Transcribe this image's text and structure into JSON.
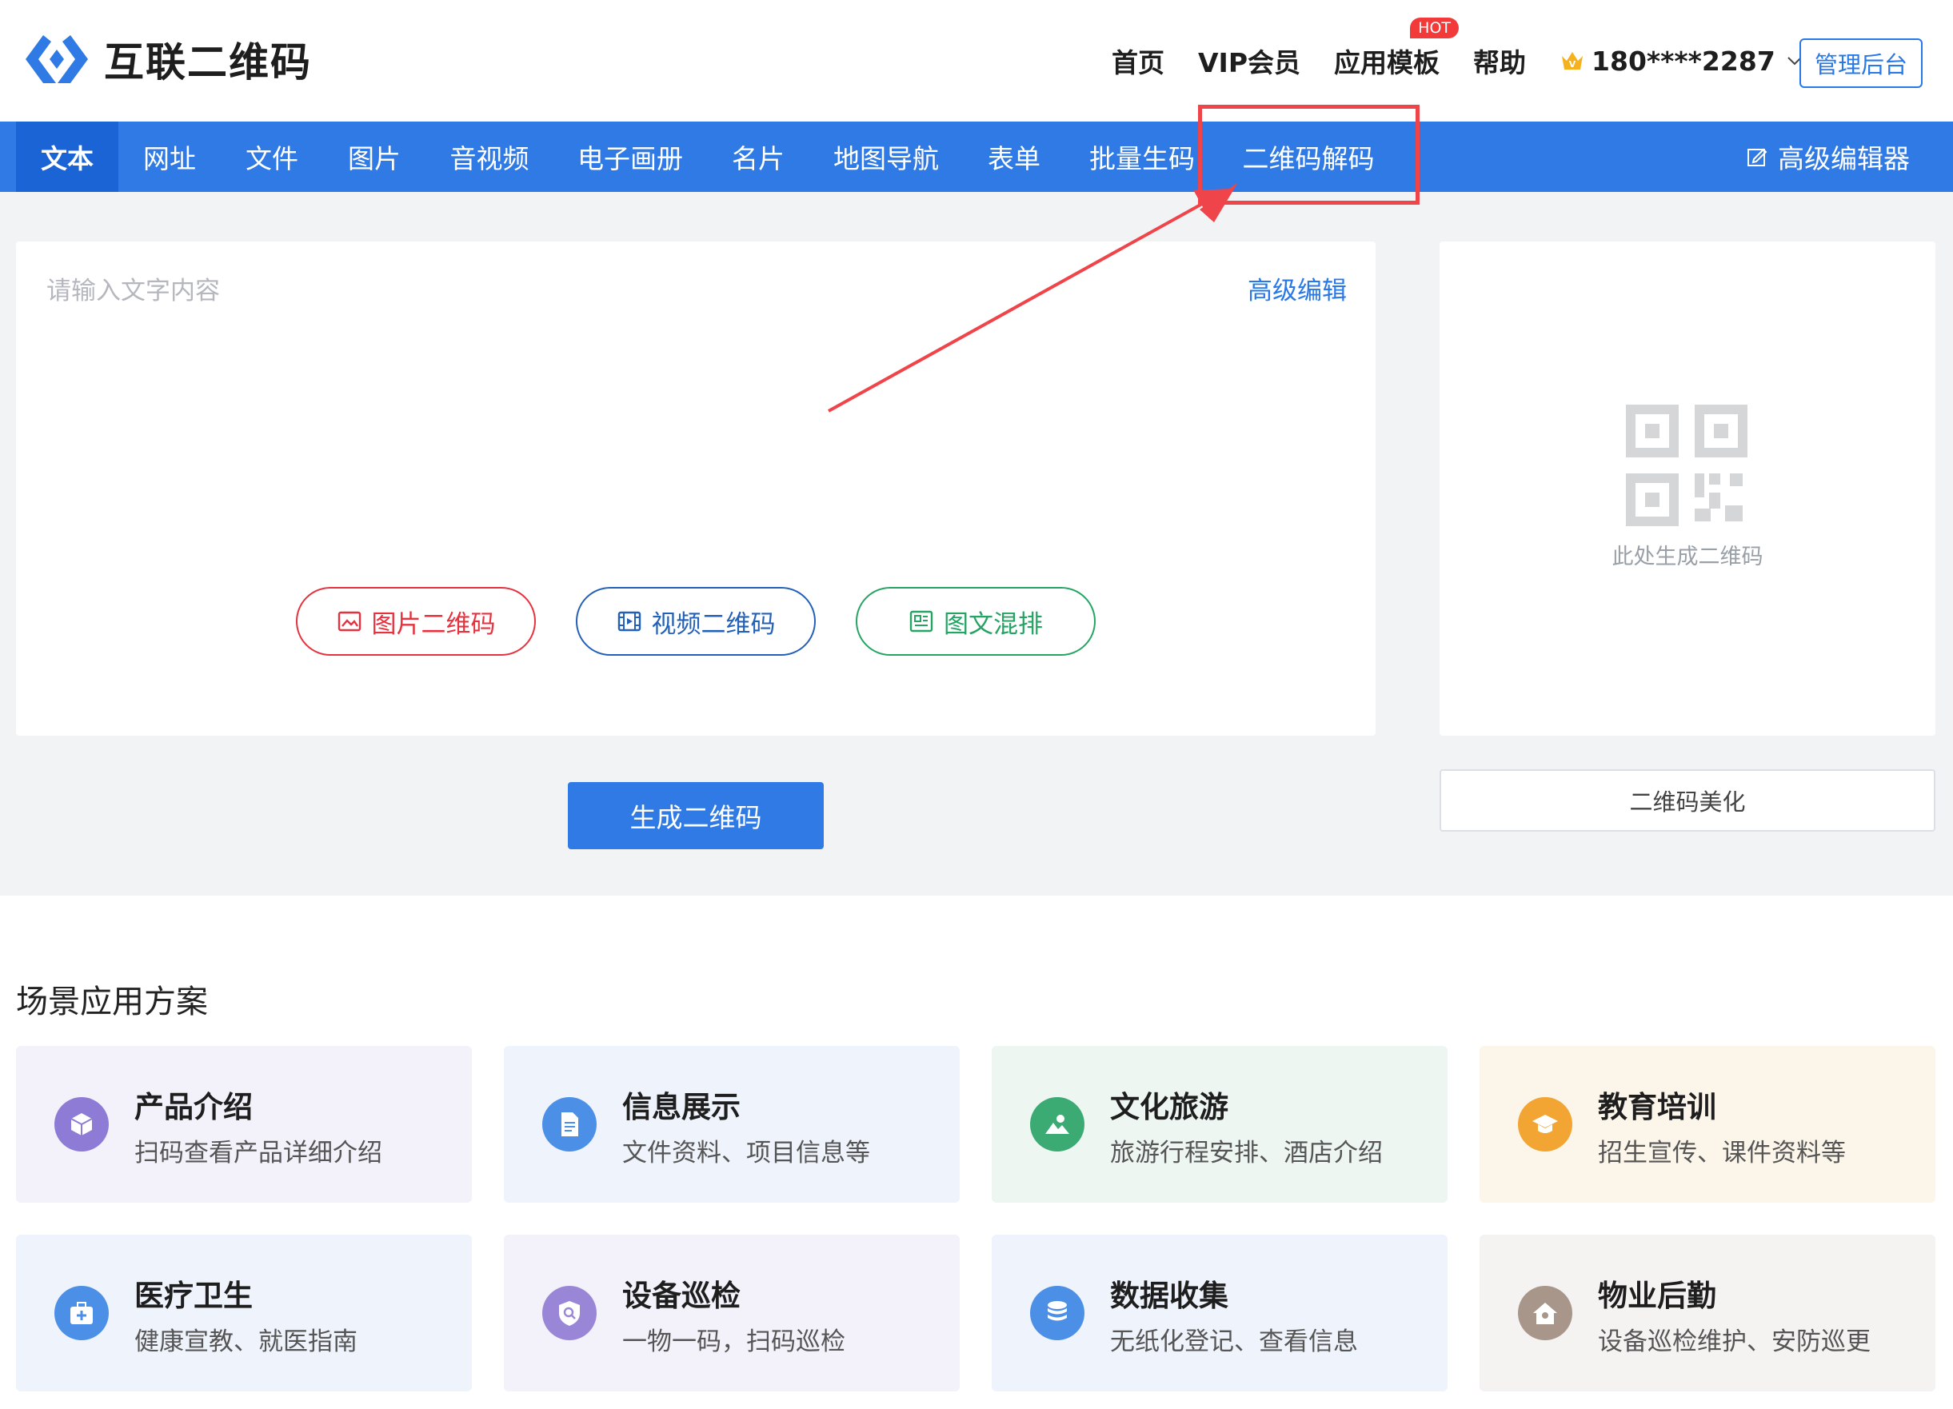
{
  "header": {
    "logo_text": "互联二维码",
    "nav": [
      "首页",
      "VIP会员",
      "应用模板",
      "帮助"
    ],
    "hot_badge": "HOT",
    "user": "180****2287",
    "admin_button": "管理后台"
  },
  "tabs": [
    "文本",
    "网址",
    "文件",
    "图片",
    "音视频",
    "电子画册",
    "名片",
    "地图导航",
    "表单",
    "批量生码",
    "二维码解码"
  ],
  "advanced_editor": "高级编辑器",
  "editor": {
    "placeholder": "请输入文字内容",
    "advanced_edit": "高级编辑",
    "image_qr": "图片二维码",
    "video_qr": "视频二维码",
    "mixed": "图文混排"
  },
  "generate_button": "生成二维码",
  "preview": {
    "text": "此处生成二维码",
    "beautify": "二维码美化"
  },
  "scenarios": {
    "title": "场景应用方案",
    "cards": [
      {
        "title": "产品介绍",
        "desc": "扫码查看产品详细介绍",
        "color": "#8e7bd6",
        "bg": "#f3f2fb",
        "icon": "cube-icon"
      },
      {
        "title": "信息展示",
        "desc": "文件资料、项目信息等",
        "color": "#4c8fe6",
        "bg": "#eef3fc",
        "icon": "document-icon"
      },
      {
        "title": "文化旅游",
        "desc": "旅游行程安排、酒店介绍",
        "color": "#3caa73",
        "bg": "#edf6f1",
        "icon": "landscape-icon"
      },
      {
        "title": "教育培训",
        "desc": "招生宣传、课件资料等",
        "color": "#f2a533",
        "bg": "#fcf5ea",
        "icon": "graduation-cap-icon"
      },
      {
        "title": "医疗卫生",
        "desc": "健康宣教、就医指南",
        "color": "#4c8fe6",
        "bg": "#eef3fc",
        "icon": "medical-kit-icon"
      },
      {
        "title": "设备巡检",
        "desc": "一物一码，扫码巡检",
        "color": "#9a86d6",
        "bg": "#f3f2fb",
        "icon": "shield-search-icon"
      },
      {
        "title": "数据收集",
        "desc": "无纸化登记、查看信息",
        "color": "#4c8fe6",
        "bg": "#eef3fc",
        "icon": "database-icon"
      },
      {
        "title": "物业后勤",
        "desc": "设备巡检维护、安防巡更",
        "color": "#a8968a",
        "bg": "#f5f3f1",
        "icon": "house-icon"
      }
    ]
  }
}
